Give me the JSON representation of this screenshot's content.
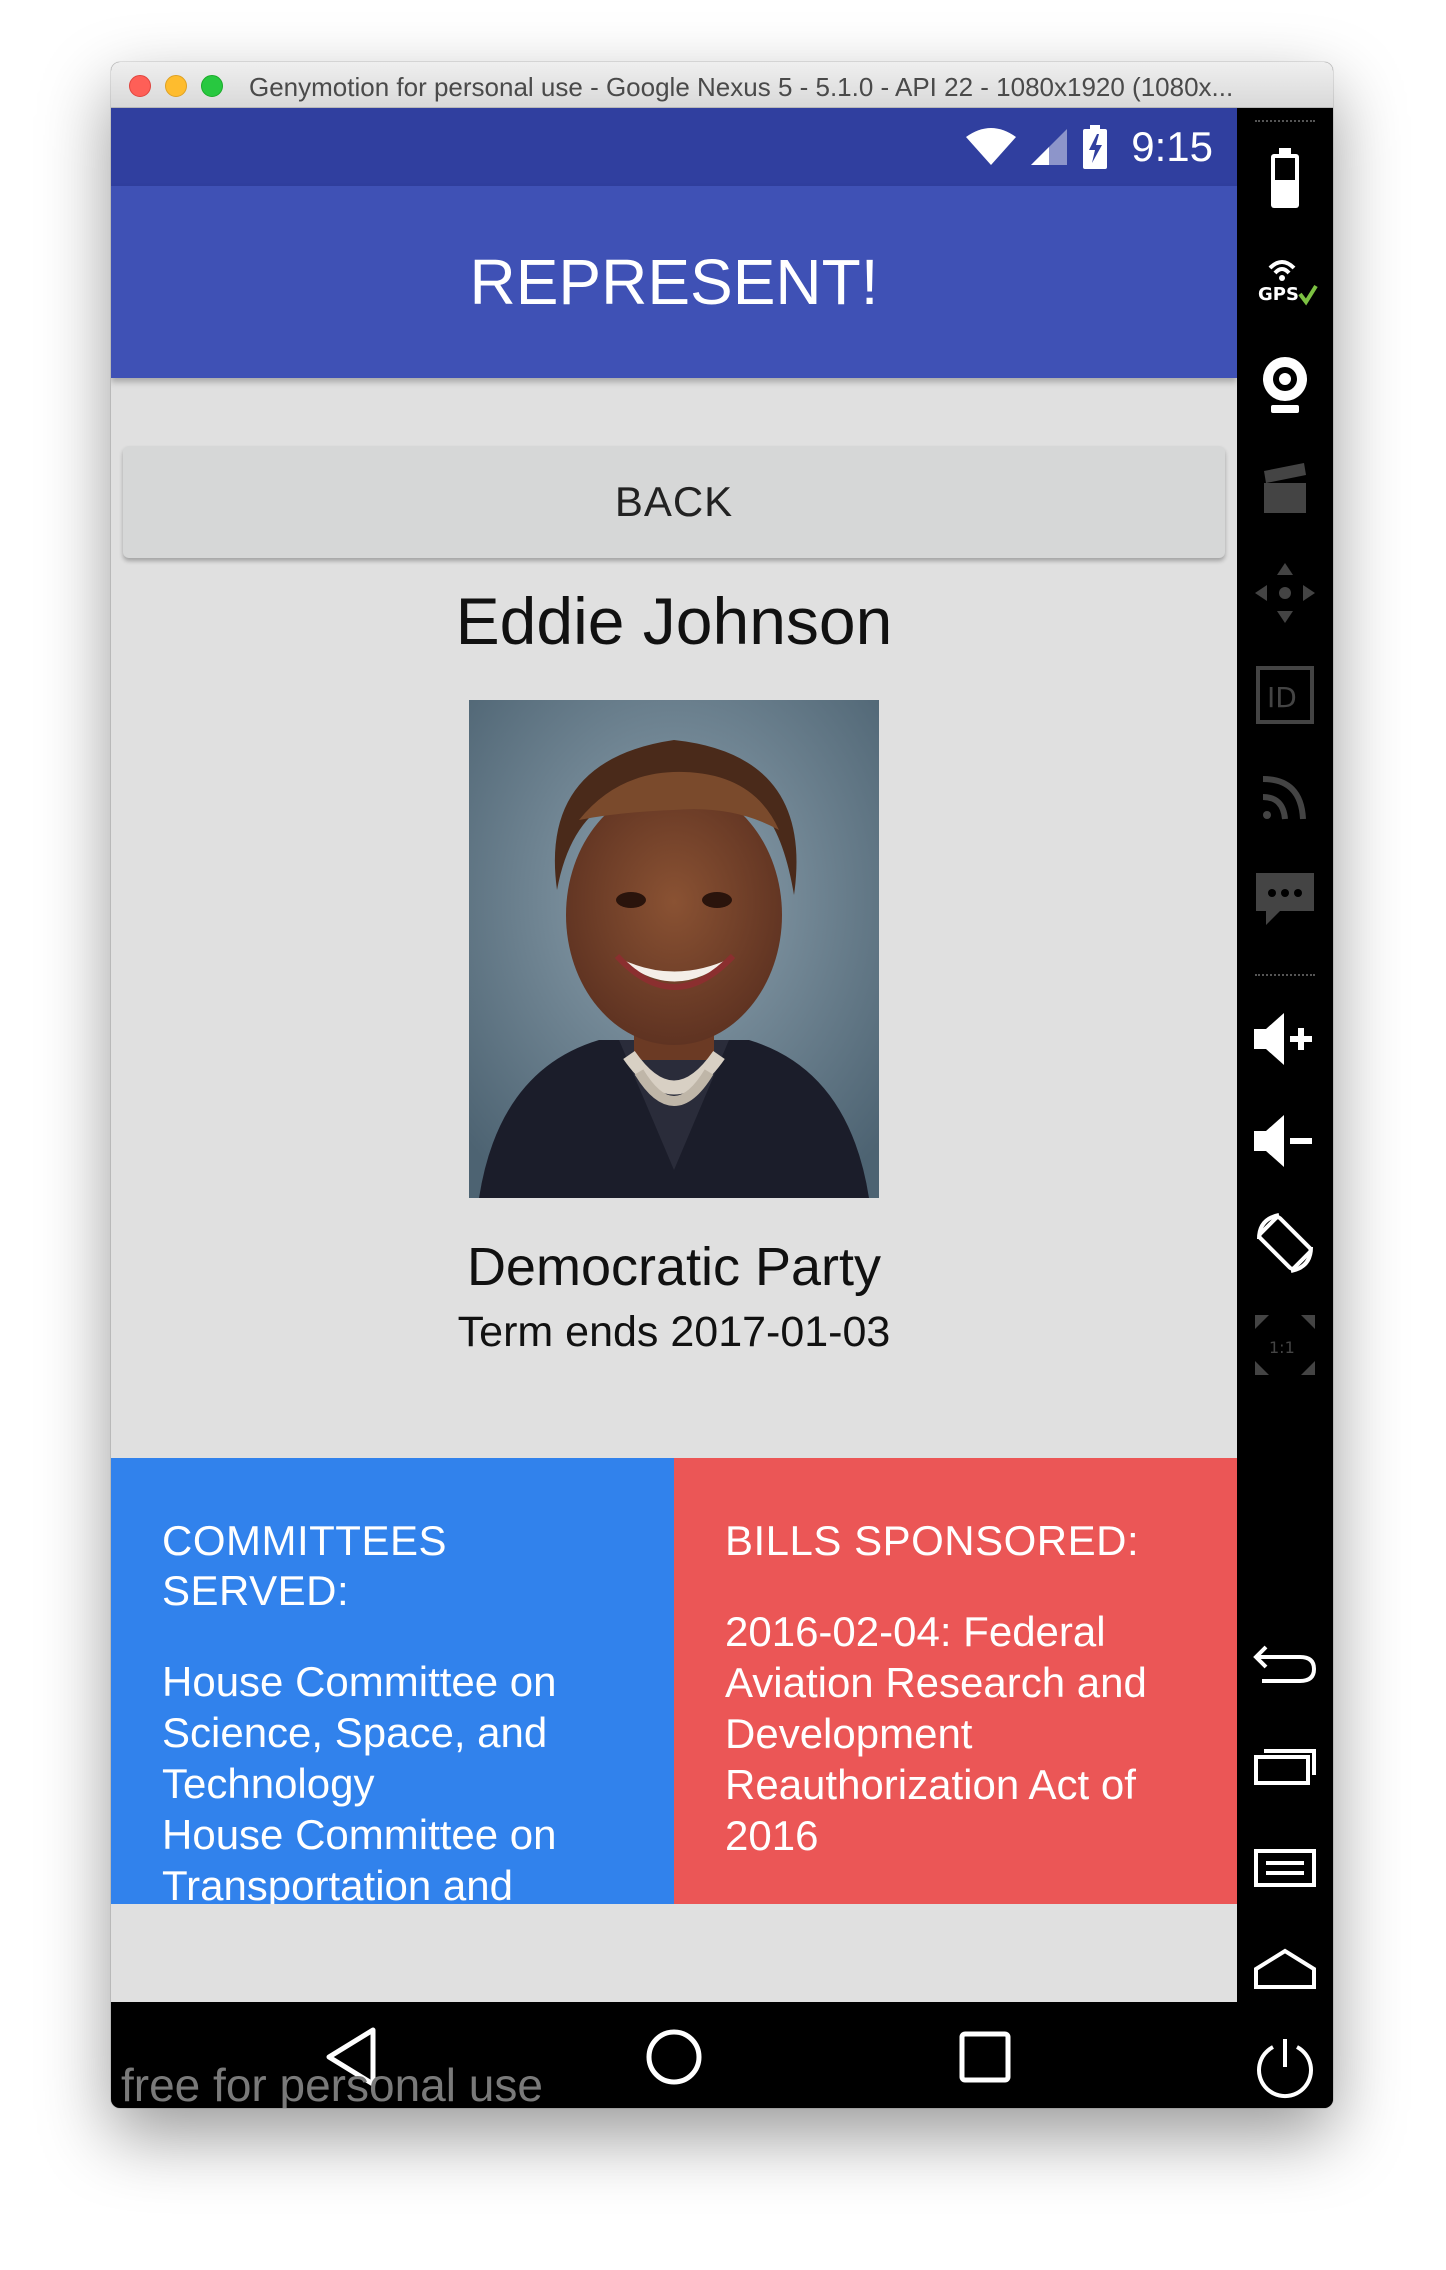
{
  "window": {
    "title": "Genymotion for personal use - Google Nexus 5 - 5.1.0 - API 22 - 1080x1920 (1080x..."
  },
  "status_bar": {
    "time": "9:15"
  },
  "app_bar": {
    "title": "REPRESENT!"
  },
  "back_button": {
    "label": "BACK"
  },
  "representative": {
    "name": "Eddie Johnson",
    "party": "Democratic Party",
    "term": "Term ends 2017-01-03"
  },
  "committees": {
    "heading": "COMMITTEES SERVED:",
    "items": [
      "House Committee on Science, Space, and Technology",
      "House Committee on Transportation and"
    ]
  },
  "bills": {
    "heading": "BILLS SPONSORED:",
    "items": [
      "2016-02-04: Federal Aviation Research and Development Reauthorization Act of 2016"
    ]
  },
  "watermark": "free for personal use",
  "sidebar_icons": [
    "battery-icon",
    "gps-icon",
    "webcam-icon",
    "capture-icon",
    "dpad-icon",
    "id-icon",
    "cast-icon",
    "sms-icon",
    "volume-up-icon",
    "volume-down-icon",
    "rotate-icon",
    "scale-icon",
    "back-icon",
    "recent-apps-icon",
    "menu-icon",
    "home-icon",
    "power-icon"
  ],
  "colors": {
    "status_bar": "#303f9f",
    "app_bar": "#3f51b5",
    "committees_panel": "#3182ec",
    "bills_panel": "#eb5656",
    "screen_background": "#e0e0e0"
  }
}
